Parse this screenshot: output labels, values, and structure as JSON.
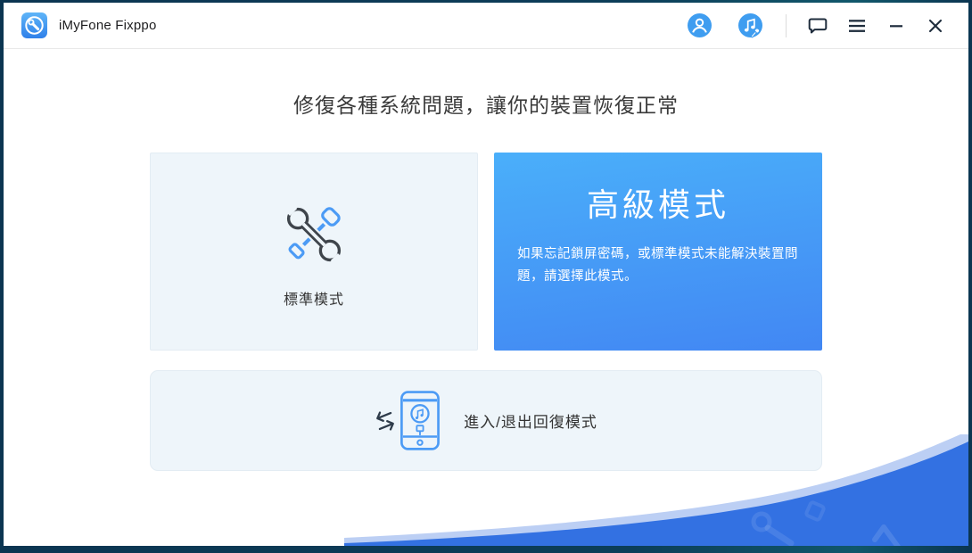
{
  "window": {
    "frame_color": "#0B3A55"
  },
  "titlebar": {
    "app_title": "iMyFone Fixppo",
    "icons": {
      "logo": "app-logo-wrench",
      "account": "user-account-icon",
      "music_tool": "itunes-repair-icon",
      "feedback": "feedback-chat-icon",
      "menu": "hamburger-menu-icon",
      "minimize": "minimize-icon",
      "close": "close-icon"
    }
  },
  "main": {
    "heading": "修復各種系統問題，讓你的裝置恢復正常",
    "cards": {
      "standard": {
        "label": "標準模式",
        "icon": "wrench-screwdriver-icon"
      },
      "advanced": {
        "title": "高級模式",
        "description": "如果忘記鎖屏密碼，或標準模式未能解決裝置問題，請選擇此模式。"
      },
      "recovery": {
        "label": "進入/退出回復模式",
        "icon": "phone-recovery-icon"
      }
    }
  },
  "colors": {
    "accent_blue": "#3F9DF0",
    "card_bg": "#EEF5FA",
    "card_border": "#E3ECF3",
    "advanced_gradient_top": "#4AAFFA",
    "advanced_gradient_bottom": "#4287F3",
    "swoosh_blue": "#3371E2",
    "swoosh_highlight": "#BCCFF4",
    "icon_dark": "#2E3B4A"
  }
}
